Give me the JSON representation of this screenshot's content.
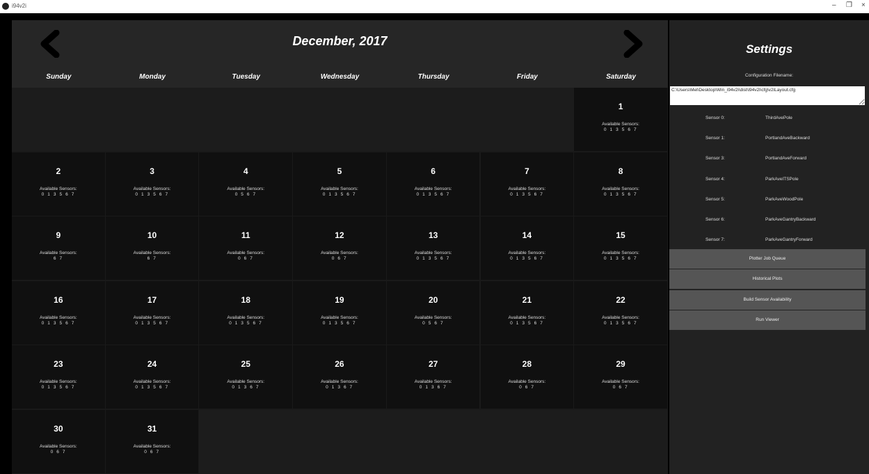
{
  "window": {
    "title": "i94v2i",
    "minimize": "–",
    "restore": "❐",
    "close": "×"
  },
  "calendar": {
    "month_title": "December, 2017",
    "prev_icon": "chevron-left-icon",
    "next_icon": "chevron-right-icon",
    "days_of_week": [
      "Sunday",
      "Monday",
      "Tuesday",
      "Wednesday",
      "Thursday",
      "Friday",
      "Saturday"
    ],
    "available_label": "Available Sensors:",
    "days": [
      {
        "day": "1",
        "col": 6,
        "row": 0,
        "sensors": "0 1 3 5 6 7"
      },
      {
        "day": "2",
        "col": 0,
        "row": 1,
        "sensors": "0 1 3 5 6 7"
      },
      {
        "day": "3",
        "col": 1,
        "row": 1,
        "sensors": "0 1 3 5 6 7"
      },
      {
        "day": "4",
        "col": 2,
        "row": 1,
        "sensors": "0 5 6 7"
      },
      {
        "day": "5",
        "col": 3,
        "row": 1,
        "sensors": "0 1 3 5 6 7"
      },
      {
        "day": "6",
        "col": 4,
        "row": 1,
        "sensors": "0 1 3 5 6 7"
      },
      {
        "day": "7",
        "col": 5,
        "row": 1,
        "sensors": "0 1 3 5 6 7"
      },
      {
        "day": "8",
        "col": 6,
        "row": 1,
        "sensors": "0 1 3 5 6 7"
      },
      {
        "day": "9",
        "col": 0,
        "row": 2,
        "sensors": "6 7"
      },
      {
        "day": "10",
        "col": 1,
        "row": 2,
        "sensors": "6 7"
      },
      {
        "day": "11",
        "col": 2,
        "row": 2,
        "sensors": "0 6 7"
      },
      {
        "day": "12",
        "col": 3,
        "row": 2,
        "sensors": "0 6 7"
      },
      {
        "day": "13",
        "col": 4,
        "row": 2,
        "sensors": "0 1 3 5 6 7"
      },
      {
        "day": "14",
        "col": 5,
        "row": 2,
        "sensors": "0 1 3 5 6 7"
      },
      {
        "day": "15",
        "col": 6,
        "row": 2,
        "sensors": "0 1 3 5 6 7"
      },
      {
        "day": "16",
        "col": 0,
        "row": 3,
        "sensors": "0 1 3 5 6 7"
      },
      {
        "day": "17",
        "col": 1,
        "row": 3,
        "sensors": "0 1 3 5 6 7"
      },
      {
        "day": "18",
        "col": 2,
        "row": 3,
        "sensors": "0 1 3 5 6 7"
      },
      {
        "day": "19",
        "col": 3,
        "row": 3,
        "sensors": "0 1 3 5 6 7"
      },
      {
        "day": "20",
        "col": 4,
        "row": 3,
        "sensors": "0 5 6 7"
      },
      {
        "day": "21",
        "col": 5,
        "row": 3,
        "sensors": "0 1 3 5 6 7"
      },
      {
        "day": "22",
        "col": 6,
        "row": 3,
        "sensors": "0 1 3 5 6 7"
      },
      {
        "day": "23",
        "col": 0,
        "row": 4,
        "sensors": "0 1 3 5 6 7"
      },
      {
        "day": "24",
        "col": 1,
        "row": 4,
        "sensors": "0 1 3 5 6 7"
      },
      {
        "day": "25",
        "col": 2,
        "row": 4,
        "sensors": "0 1 3 6 7"
      },
      {
        "day": "26",
        "col": 3,
        "row": 4,
        "sensors": "0 1 3 6 7"
      },
      {
        "day": "27",
        "col": 4,
        "row": 4,
        "sensors": "0 1 3 6 7"
      },
      {
        "day": "28",
        "col": 5,
        "row": 4,
        "sensors": "0 6 7"
      },
      {
        "day": "29",
        "col": 6,
        "row": 4,
        "sensors": "0 6 7"
      },
      {
        "day": "30",
        "col": 0,
        "row": 5,
        "sensors": "0 6 7"
      },
      {
        "day": "31",
        "col": 1,
        "row": 5,
        "sensors": "0 6 7"
      }
    ]
  },
  "settings": {
    "title": "Settings",
    "config_label": "Configuration Filename:",
    "config_value": "C:\\Users\\Mel\\Desktop\\Win_i94v2i\\dist\\i94v2i\\cfg\\v2iLayout.cfg",
    "sensors": [
      {
        "label": "Sensor 0:",
        "name": "ThirdAvePole"
      },
      {
        "label": "Sensor 1:",
        "name": "PortlandAveBackward"
      },
      {
        "label": "Sensor 3:",
        "name": "PortlandAveForward"
      },
      {
        "label": "Sensor 4:",
        "name": "ParkAveITSPole"
      },
      {
        "label": "Sensor 5:",
        "name": "ParkAveWoodPole"
      },
      {
        "label": "Sensor 6:",
        "name": "ParkAveGantryBackward"
      },
      {
        "label": "Sensor 7:",
        "name": "ParkAveGantryForward"
      }
    ],
    "buttons": [
      "Plotter Job Queue",
      "Historical Plots",
      "Build Sensor Availability",
      "Run Viewer"
    ]
  }
}
